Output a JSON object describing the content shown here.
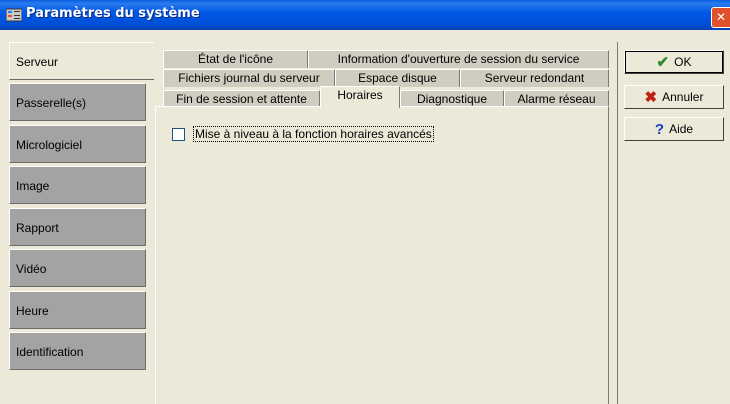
{
  "window": {
    "title": "Paramètres du système",
    "close_glyph": "✕"
  },
  "sidebar": {
    "items": [
      {
        "label": "Serveur",
        "selected": true
      },
      {
        "label": "Passerelle(s)",
        "selected": false
      },
      {
        "label": "Micrologiciel",
        "selected": false
      },
      {
        "label": "Image",
        "selected": false
      },
      {
        "label": "Rapport",
        "selected": false
      },
      {
        "label": "Vidéo",
        "selected": false
      },
      {
        "label": "Heure",
        "selected": false
      },
      {
        "label": "Identification",
        "selected": false
      }
    ]
  },
  "tabs": {
    "row1": [
      "État de l'icône",
      "Information d'ouverture de session du service"
    ],
    "row2": [
      "Fichiers journal du serveur",
      "Espace disque",
      "Serveur redondant"
    ],
    "row3": [
      "Fin de session et attente",
      "Horaires",
      "Diagnostique",
      "Alarme réseau"
    ],
    "active": "Horaires"
  },
  "content": {
    "advanced_schedule_checkbox": {
      "label": "Mise à niveau à la fonction horaires avancés",
      "checked": false
    }
  },
  "buttons": {
    "ok": "OK",
    "cancel": "Annuler",
    "help": "Aide"
  },
  "icons": {
    "ok": "checkmark-icon",
    "cancel": "x-icon",
    "help": "question-icon"
  },
  "colors": {
    "titlebar": "#0058E6",
    "face": "#ECE9D8",
    "sidebar_item": "#A3A3A3",
    "ok_icon": "#2E8B2E",
    "cancel_icon": "#C02010",
    "help_icon": "#1040C0"
  }
}
